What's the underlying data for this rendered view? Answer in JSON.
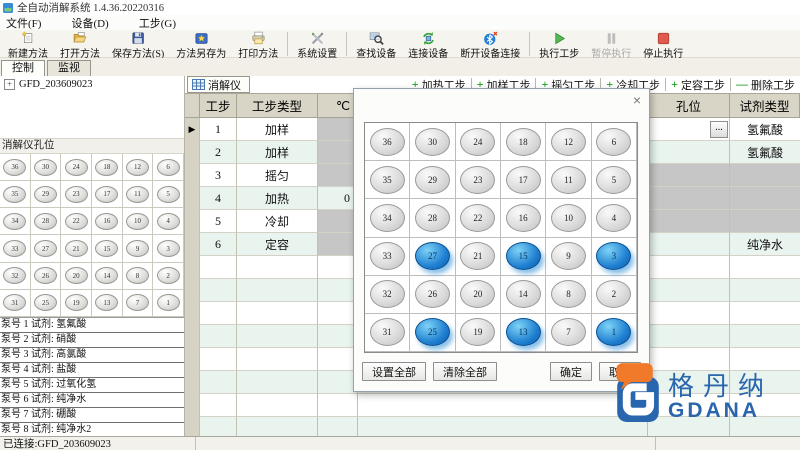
{
  "window": {
    "title": "全自动消解系统 1.4.36.20220316"
  },
  "menu": {
    "items": [
      "文件(F)",
      "设备(D)",
      "工步(G)"
    ]
  },
  "toolbar": {
    "buttons": [
      {
        "id": "new-method",
        "label": "新建方法",
        "icon": "new-method-icon"
      },
      {
        "id": "open-method",
        "label": "打开方法",
        "icon": "open-method-icon"
      },
      {
        "id": "save-method",
        "label": "保存方法(S)",
        "icon": "save-method-icon"
      },
      {
        "id": "save-as",
        "label": "方法另存为",
        "icon": "save-as-icon"
      },
      {
        "id": "print-method",
        "label": "打印方法",
        "icon": "print-method-icon",
        "sep_after": true
      },
      {
        "id": "system-settings",
        "label": "系统设置",
        "icon": "system-settings-icon",
        "sep_after": true
      },
      {
        "id": "find-device",
        "label": "查找设备",
        "icon": "find-device-icon"
      },
      {
        "id": "connect-device",
        "label": "连接设备",
        "icon": "connect-device-icon"
      },
      {
        "id": "disconnect-device",
        "label": "断开设备连接",
        "icon": "disconnect-device-icon",
        "sep_after": true
      },
      {
        "id": "run-step",
        "label": "执行工步",
        "icon": "run-step-icon"
      },
      {
        "id": "pause-run",
        "label": "暂停执行",
        "icon": "pause-icon",
        "disabled": true
      },
      {
        "id": "stop-run",
        "label": "停止执行",
        "icon": "stop-icon"
      }
    ]
  },
  "view_tabs": [
    {
      "label": "控制",
      "active": true
    },
    {
      "label": "监视",
      "active": false
    }
  ],
  "tree": {
    "root": "GFD_203609023",
    "expander": "+"
  },
  "device_tab": {
    "label": "消解仪"
  },
  "step_buttons": [
    {
      "sign": "+",
      "label": "加热工步"
    },
    {
      "sign": "+",
      "label": "加样工步"
    },
    {
      "sign": "+",
      "label": "摇匀工步"
    },
    {
      "sign": "+",
      "label": "冷却工步"
    },
    {
      "sign": "+",
      "label": "定容工步"
    },
    {
      "sign": "—",
      "label": "删除工步"
    }
  ],
  "table": {
    "headers": {
      "step": "工步",
      "type": "工步类型",
      "temp": "℃",
      "fill": "",
      "hole": "孔位",
      "reagent": "试剂类型"
    },
    "rows": [
      {
        "step": "1",
        "type": "加样",
        "temp": "",
        "hole": "",
        "reagent": "氢氟酸",
        "selected": true,
        "hole_button": true,
        "temp_gray": true,
        "hole_gray": false,
        "reagent_gray": false
      },
      {
        "step": "2",
        "type": "加样",
        "temp": "",
        "hole": "",
        "reagent": "氢氟酸",
        "temp_gray": true,
        "hole_gray": false,
        "reagent_gray": false
      },
      {
        "step": "3",
        "type": "摇匀",
        "temp": "",
        "hole": "",
        "reagent": "",
        "temp_gray": true,
        "hole_gray": true,
        "reagent_gray": true
      },
      {
        "step": "4",
        "type": "加热",
        "temp": "0",
        "hole": "",
        "reagent": "",
        "temp_gray": false,
        "hole_gray": true,
        "reagent_gray": true
      },
      {
        "step": "5",
        "type": "冷却",
        "temp": "",
        "hole": "",
        "reagent": "",
        "temp_gray": true,
        "hole_gray": true,
        "reagent_gray": true
      },
      {
        "step": "6",
        "type": "定容",
        "temp": "",
        "hole": "",
        "reagent": "纯净水",
        "temp_gray": true,
        "hole_gray": false,
        "reagent_gray": false
      }
    ],
    "empty_rows": 8,
    "hole_ellipsis": "..."
  },
  "hole_panel": {
    "title": "消解仪孔位"
  },
  "holes": {
    "grid": [
      [
        36,
        30,
        24,
        18,
        12,
        6
      ],
      [
        35,
        29,
        23,
        17,
        11,
        5
      ],
      [
        34,
        28,
        22,
        16,
        10,
        4
      ],
      [
        33,
        27,
        21,
        15,
        9,
        3
      ],
      [
        32,
        26,
        20,
        14,
        8,
        2
      ],
      [
        31,
        25,
        19,
        13,
        7,
        1
      ]
    ]
  },
  "dialog": {
    "close": "×",
    "selected": [
      27,
      15,
      3,
      25,
      13,
      1
    ],
    "buttons": [
      {
        "label": "设置全部",
        "align": "left"
      },
      {
        "label": "清除全部",
        "align": "left"
      },
      {
        "label": "确定",
        "align": "right"
      },
      {
        "label": "取消",
        "align": "right"
      }
    ]
  },
  "pumps": [
    "泵号 1 试剂: 氢氟酸",
    "泵号 2 试剂: 硝酸",
    "泵号 3 试剂: 高氯酸",
    "泵号 4 试剂: 盐酸",
    "泵号 5 试剂: 过氧化氢",
    "泵号 6 试剂: 纯净水",
    "泵号 7 试剂: 硼酸",
    "泵号 8 试剂: 纯净水2"
  ],
  "status": {
    "connection": "已连接:GFD_203609023"
  },
  "logo": {
    "cn": "格丹纳",
    "en": "GDANA"
  },
  "colors": {
    "accent_blue": "#1f7fd0",
    "logo_blue": "#2a66ad",
    "logo_orange": "#f07a2a",
    "sign_green": "#1a9c1a",
    "header_bg": "#d8d5c6",
    "gray_cell": "#c6c6c6",
    "pale_row": "#e9f4ef"
  }
}
